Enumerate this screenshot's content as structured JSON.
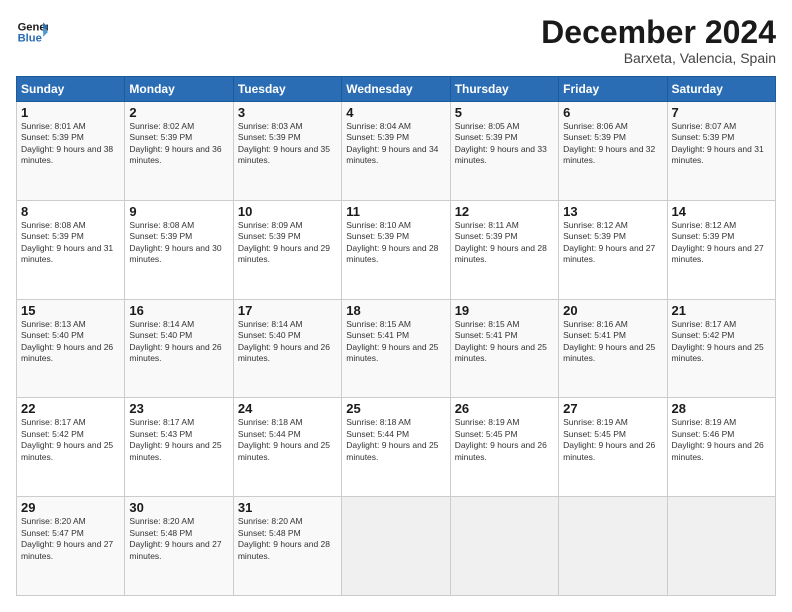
{
  "header": {
    "logo_line1": "General",
    "logo_line2": "Blue",
    "month": "December 2024",
    "location": "Barxeta, Valencia, Spain"
  },
  "days_of_week": [
    "Sunday",
    "Monday",
    "Tuesday",
    "Wednesday",
    "Thursday",
    "Friday",
    "Saturday"
  ],
  "weeks": [
    [
      {
        "num": "1",
        "rise": "8:01 AM",
        "set": "5:39 PM",
        "daylight": "9 hours and 38 minutes."
      },
      {
        "num": "2",
        "rise": "8:02 AM",
        "set": "5:39 PM",
        "daylight": "9 hours and 36 minutes."
      },
      {
        "num": "3",
        "rise": "8:03 AM",
        "set": "5:39 PM",
        "daylight": "9 hours and 35 minutes."
      },
      {
        "num": "4",
        "rise": "8:04 AM",
        "set": "5:39 PM",
        "daylight": "9 hours and 34 minutes."
      },
      {
        "num": "5",
        "rise": "8:05 AM",
        "set": "5:39 PM",
        "daylight": "9 hours and 33 minutes."
      },
      {
        "num": "6",
        "rise": "8:06 AM",
        "set": "5:39 PM",
        "daylight": "9 hours and 32 minutes."
      },
      {
        "num": "7",
        "rise": "8:07 AM",
        "set": "5:39 PM",
        "daylight": "9 hours and 31 minutes."
      }
    ],
    [
      {
        "num": "8",
        "rise": "8:08 AM",
        "set": "5:39 PM",
        "daylight": "9 hours and 31 minutes."
      },
      {
        "num": "9",
        "rise": "8:08 AM",
        "set": "5:39 PM",
        "daylight": "9 hours and 30 minutes."
      },
      {
        "num": "10",
        "rise": "8:09 AM",
        "set": "5:39 PM",
        "daylight": "9 hours and 29 minutes."
      },
      {
        "num": "11",
        "rise": "8:10 AM",
        "set": "5:39 PM",
        "daylight": "9 hours and 28 minutes."
      },
      {
        "num": "12",
        "rise": "8:11 AM",
        "set": "5:39 PM",
        "daylight": "9 hours and 28 minutes."
      },
      {
        "num": "13",
        "rise": "8:12 AM",
        "set": "5:39 PM",
        "daylight": "9 hours and 27 minutes."
      },
      {
        "num": "14",
        "rise": "8:12 AM",
        "set": "5:39 PM",
        "daylight": "9 hours and 27 minutes."
      }
    ],
    [
      {
        "num": "15",
        "rise": "8:13 AM",
        "set": "5:40 PM",
        "daylight": "9 hours and 26 minutes."
      },
      {
        "num": "16",
        "rise": "8:14 AM",
        "set": "5:40 PM",
        "daylight": "9 hours and 26 minutes."
      },
      {
        "num": "17",
        "rise": "8:14 AM",
        "set": "5:40 PM",
        "daylight": "9 hours and 26 minutes."
      },
      {
        "num": "18",
        "rise": "8:15 AM",
        "set": "5:41 PM",
        "daylight": "9 hours and 25 minutes."
      },
      {
        "num": "19",
        "rise": "8:15 AM",
        "set": "5:41 PM",
        "daylight": "9 hours and 25 minutes."
      },
      {
        "num": "20",
        "rise": "8:16 AM",
        "set": "5:41 PM",
        "daylight": "9 hours and 25 minutes."
      },
      {
        "num": "21",
        "rise": "8:17 AM",
        "set": "5:42 PM",
        "daylight": "9 hours and 25 minutes."
      }
    ],
    [
      {
        "num": "22",
        "rise": "8:17 AM",
        "set": "5:42 PM",
        "daylight": "9 hours and 25 minutes."
      },
      {
        "num": "23",
        "rise": "8:17 AM",
        "set": "5:43 PM",
        "daylight": "9 hours and 25 minutes."
      },
      {
        "num": "24",
        "rise": "8:18 AM",
        "set": "5:44 PM",
        "daylight": "9 hours and 25 minutes."
      },
      {
        "num": "25",
        "rise": "8:18 AM",
        "set": "5:44 PM",
        "daylight": "9 hours and 25 minutes."
      },
      {
        "num": "26",
        "rise": "8:19 AM",
        "set": "5:45 PM",
        "daylight": "9 hours and 26 minutes."
      },
      {
        "num": "27",
        "rise": "8:19 AM",
        "set": "5:45 PM",
        "daylight": "9 hours and 26 minutes."
      },
      {
        "num": "28",
        "rise": "8:19 AM",
        "set": "5:46 PM",
        "daylight": "9 hours and 26 minutes."
      }
    ],
    [
      {
        "num": "29",
        "rise": "8:20 AM",
        "set": "5:47 PM",
        "daylight": "9 hours and 27 minutes."
      },
      {
        "num": "30",
        "rise": "8:20 AM",
        "set": "5:48 PM",
        "daylight": "9 hours and 27 minutes."
      },
      {
        "num": "31",
        "rise": "8:20 AM",
        "set": "5:48 PM",
        "daylight": "9 hours and 28 minutes."
      },
      null,
      null,
      null,
      null
    ]
  ]
}
